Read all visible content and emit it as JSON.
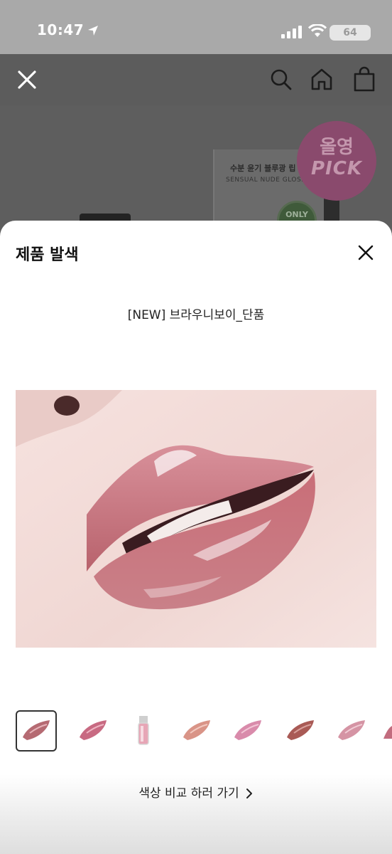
{
  "status_bar": {
    "time": "10:47",
    "battery": "64"
  },
  "background_product": {
    "box_line1": "수분 윤기 블루광 립",
    "box_line2": "SENSUAL NUDE GLOSS",
    "only_badge": "ONLY",
    "pick_badge_top": "올영",
    "pick_badge_bottom": "PICK"
  },
  "sheet": {
    "title": "제품 발색",
    "variant_name": "[NEW] 브라우니보이_단품",
    "compare_link": "색상 비교 하러 가기",
    "thumbnails": [
      {
        "name": "swatch-1",
        "color": "#b56a72",
        "selected": true
      },
      {
        "name": "swatch-2",
        "color": "#c86a82"
      },
      {
        "name": "swatch-3-tube",
        "color": "#e7a6b6"
      },
      {
        "name": "swatch-4",
        "color": "#d99487"
      },
      {
        "name": "swatch-5",
        "color": "#d98bab"
      },
      {
        "name": "swatch-6",
        "color": "#a95a55"
      },
      {
        "name": "swatch-7",
        "color": "#d594a4"
      },
      {
        "name": "swatch-8",
        "color": "#c26c7e"
      }
    ]
  },
  "colors": {
    "lip_base": "#c9737c",
    "lip_dark": "#9c4f58",
    "skin": "#f2dcd8",
    "sheet_bg": "#ffffff",
    "dim_bg": "#5e5e5e"
  }
}
